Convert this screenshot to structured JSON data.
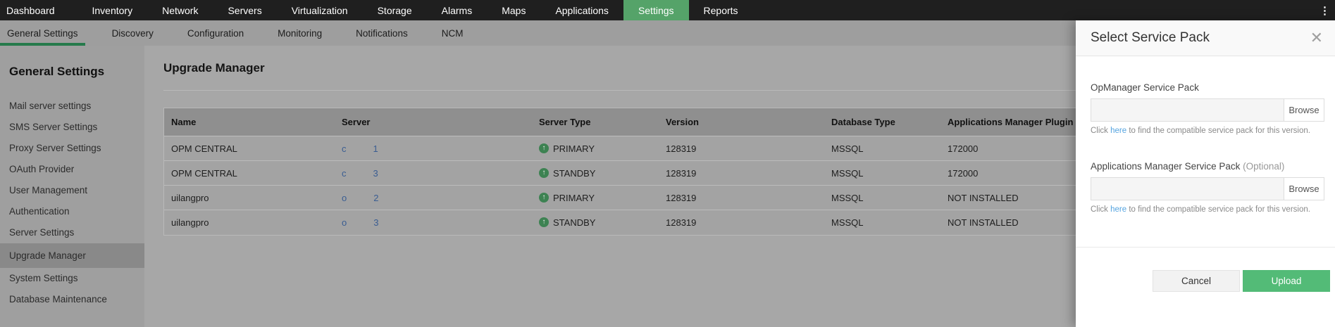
{
  "topnav": {
    "items": [
      {
        "label": "Dashboard",
        "active": false
      },
      {
        "label": "Inventory",
        "active": false
      },
      {
        "label": "Network",
        "active": false
      },
      {
        "label": "Servers",
        "active": false
      },
      {
        "label": "Virtualization",
        "active": false
      },
      {
        "label": "Storage",
        "active": false
      },
      {
        "label": "Alarms",
        "active": false
      },
      {
        "label": "Maps",
        "active": false
      },
      {
        "label": "Applications",
        "active": false
      },
      {
        "label": "Settings",
        "active": true
      },
      {
        "label": "Reports",
        "active": false
      }
    ],
    "overflow_menu_icon": "⋮"
  },
  "subnav": {
    "items": [
      {
        "label": "General Settings",
        "active": true
      },
      {
        "label": "Discovery",
        "active": false
      },
      {
        "label": "Configuration",
        "active": false
      },
      {
        "label": "Monitoring",
        "active": false
      },
      {
        "label": "Notifications",
        "active": false
      },
      {
        "label": "NCM",
        "active": false
      }
    ]
  },
  "sidebar": {
    "heading": "General Settings",
    "items": [
      {
        "label": "Mail server settings",
        "selected": false
      },
      {
        "label": "SMS Server Settings",
        "selected": false
      },
      {
        "label": "Proxy Server Settings",
        "selected": false
      },
      {
        "label": "OAuth Provider",
        "selected": false
      },
      {
        "label": "User Management",
        "selected": false
      },
      {
        "label": "Authentication",
        "selected": false
      },
      {
        "label": "Server Settings",
        "selected": false
      },
      {
        "label": "Upgrade Manager",
        "selected": true
      },
      {
        "label": "System Settings",
        "selected": false
      },
      {
        "label": "Database Maintenance",
        "selected": false
      }
    ]
  },
  "main": {
    "title": "Upgrade Manager",
    "table": {
      "columns": [
        "Name",
        "Server",
        "Server Type",
        "Version",
        "Database Type",
        "Applications Manager Plugin"
      ],
      "rows": [
        {
          "name": "OPM CENTRAL",
          "server_letter": "c",
          "server_link": "1",
          "server_type": "PRIMARY",
          "version": "128319",
          "database_type": "MSSQL",
          "plugin": "172000"
        },
        {
          "name": "OPM CENTRAL",
          "server_letter": "c",
          "server_link": "3",
          "server_type": "STANDBY",
          "version": "128319",
          "database_type": "MSSQL",
          "plugin": "172000"
        },
        {
          "name": "uilangpro",
          "server_letter": "o",
          "server_link": "2",
          "server_type": "PRIMARY",
          "version": "128319",
          "database_type": "MSSQL",
          "plugin": "NOT INSTALLED"
        },
        {
          "name": "uilangpro",
          "server_letter": "o",
          "server_link": "3",
          "server_type": "STANDBY",
          "version": "128319",
          "database_type": "MSSQL",
          "plugin": "NOT INSTALLED"
        }
      ],
      "status_up_icon": "↑"
    }
  },
  "panel": {
    "title": "Select Service Pack",
    "close_icon": "✕",
    "opmanager": {
      "label": "OpManager Service Pack",
      "input_value": "",
      "browse_label": "Browse"
    },
    "appmanager": {
      "label": "Applications Manager Service Pack",
      "optional": "(Optional)",
      "input_value": "",
      "browse_label": "Browse"
    },
    "hint": {
      "prefix": "Click",
      "link": "here",
      "suffix": "to find the compatible service pack for this version."
    },
    "cancel_label": "Cancel",
    "upload_label": "Upload"
  },
  "colors": {
    "topnav_active_green": "#55a369",
    "subnav_active_underline": "#267a4b",
    "upload_green": "#53bb77",
    "table_link_blue": "#3a5d92",
    "hint_link_blue": "#55a4e0",
    "status_green": "#3d8252"
  }
}
